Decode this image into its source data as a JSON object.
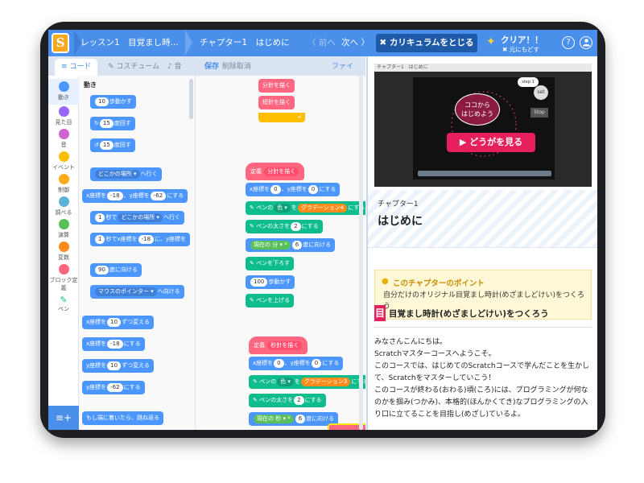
{
  "topbar": {
    "logo": "S",
    "lesson": "レッスン1　目覚まし時...",
    "chapter": "チャプター1　はじめに",
    "prev": "〈 前へ",
    "next": "次へ 〉",
    "close_curriculum": "✖ カリキュラムをとじる",
    "clear": "クリア！！",
    "undo_clear": "✖ 元にもどす",
    "help_icon": "?",
    "account_icon": "person"
  },
  "editor": {
    "tabs": [
      "コード",
      "コスチューム",
      "音"
    ],
    "save": "保存",
    "delete_cancel": "削除取消",
    "file": "ファイル ▾",
    "categories": [
      {
        "label": "動き",
        "color": "#4c97ff"
      },
      {
        "label": "見た目",
        "color": "#9966ff"
      },
      {
        "label": "音",
        "color": "#cf63cf"
      },
      {
        "label": "イベント",
        "color": "#ffbf00"
      },
      {
        "label": "制御",
        "color": "#ffab19"
      },
      {
        "label": "調べる",
        "color": "#5cb1d6"
      },
      {
        "label": "演算",
        "color": "#59c059"
      },
      {
        "label": "変数",
        "color": "#ff8c1a"
      },
      {
        "label": "ブロック定義",
        "color": "#ff6680"
      },
      {
        "label": "ペン",
        "color": "#0fbd8c"
      }
    ],
    "palette_title": "動き",
    "palette_blocks": {
      "move": [
        "10",
        "歩動かす"
      ],
      "turn_right": [
        "15",
        "度回す"
      ],
      "turn_left": [
        "15",
        "度回す"
      ],
      "goto": [
        "どこかの場所 ▾",
        "へ行く"
      ],
      "goto_xy": [
        "x座標を",
        "-18",
        "、y座標を",
        "-62",
        "にする"
      ],
      "glide": [
        "1",
        "秒で",
        "どこかの場所 ▾",
        "へ行く"
      ],
      "glide_xy": [
        "1",
        "秒でx座標を",
        "-18",
        "に、y座標を"
      ],
      "point_dir": [
        "90",
        "度に向ける"
      ],
      "point_towards": [
        "マウスのポインター ▾",
        "へ向ける"
      ],
      "change_x": [
        "x座標を",
        "10",
        "ずつ変える"
      ],
      "set_x": [
        "x座標を",
        "-18",
        "にする"
      ],
      "change_y": [
        "y座標を",
        "10",
        "ずつ変える"
      ],
      "set_y": [
        "y座標を",
        "-62",
        "にする"
      ],
      "bounce": [
        "もし端に着いたら、跳ね返る"
      ]
    },
    "workspace": {
      "top1": "分針を描く",
      "top2": "短針を描く",
      "def1": [
        "定義",
        "分針を描く"
      ],
      "def2": [
        "定義",
        "秒針を描く"
      ],
      "goto00": [
        "x座標を",
        "0",
        "、y座標を",
        "0",
        "にする"
      ],
      "pen_color4": [
        "ペンの",
        "色 ▾",
        "を",
        "グラデーション4",
        "にする"
      ],
      "pen_color3": [
        "ペンの",
        "色 ▾",
        "を",
        "グラデーション3",
        "にする"
      ],
      "pen_size2": [
        "ペンの太さを",
        "2",
        "にする"
      ],
      "point_min": [
        "現在の",
        "分 ▾",
        "*",
        "6",
        "度に向ける"
      ],
      "point_sec": [
        "現在の",
        "秒 ▾",
        "*",
        "6",
        "度に向ける"
      ],
      "pen_down": "ペンを下ろす",
      "move100": [
        "100",
        "歩動かす"
      ],
      "pen_up": "ペンを上げる",
      "move_partial": "100"
    }
  },
  "video": {
    "header": "チャプター1　はじめに",
    "bubble_line1": "ココから",
    "bubble_line2": "はじめよう",
    "play": "どうがを見る",
    "sprite_label1": "set",
    "sprite_label2": "Stop",
    "sprite_label3": "step 1"
  },
  "chapter": {
    "number": "チャプター1",
    "title": "はじめに"
  },
  "point": {
    "heading": "このチャプターのポイント",
    "text": "自分だけのオリジナル目覚まし時計(めざましどけい)をつくろう"
  },
  "content": {
    "heading": "目覚まし時計(めざましどけい)をつくろう",
    "p1": "みなさんこんにちは。",
    "p2": "Scratchマスターコースへようこそ。",
    "p3": "このコースでは、はじめてのScratchコースで学んだことを生かして、Scratchをマスターしていこう！",
    "p4": "このコースが終わる(おわる)頃(ころ)には、プログラミングが何なのかを掴み(つかみ)、本格的(ほんかくてき)なプログラミングの入り口に立てることを目指し(めざし)ているよ。"
  },
  "colors": {
    "accent": "#4a8fe9",
    "close_btn": "#1e5aa8",
    "play": "#e5205c"
  }
}
